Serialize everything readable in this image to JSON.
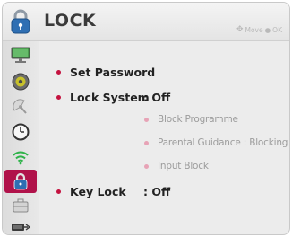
{
  "header": {
    "title": "LOCK",
    "hint_move": "Move",
    "hint_ok": "OK"
  },
  "sidebar": {
    "items": [
      {
        "icon": "picture-icon"
      },
      {
        "icon": "sound-icon"
      },
      {
        "icon": "channel-icon"
      },
      {
        "icon": "time-icon"
      },
      {
        "icon": "network-icon"
      },
      {
        "icon": "lock-icon",
        "active": true
      },
      {
        "icon": "option-icon"
      },
      {
        "icon": "input-icon"
      }
    ]
  },
  "menu": {
    "set_password": "Set Password",
    "lock_system": {
      "label": "Lock System",
      "value": ": Off"
    },
    "sub_items": {
      "block_programme": "Block Programme",
      "parental_guidance": "Parental Guidance : Blocking Off",
      "input_block": "Input Block"
    },
    "key_lock": {
      "label": "Key Lock",
      "value": ": Off"
    }
  },
  "colors": {
    "accent": "#b0124a",
    "bullet": "#c4123f",
    "dimmed_text": "#9c9c9c"
  }
}
